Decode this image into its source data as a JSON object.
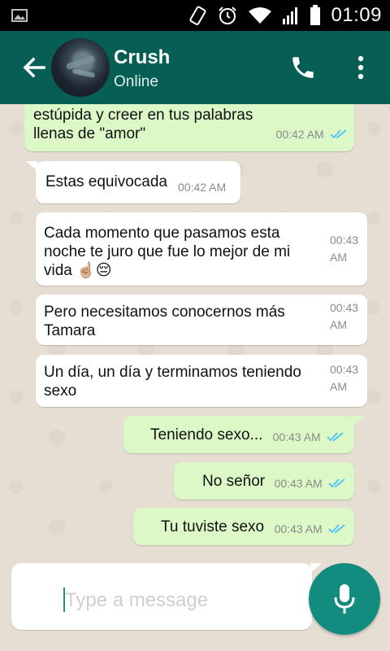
{
  "status_bar": {
    "time": "01:09"
  },
  "header": {
    "contact_name": "Crush",
    "contact_status": "Online"
  },
  "messages": [
    {
      "dir": "in",
      "text": "estúpida y creer en tus palabras llenas de \"amor\"",
      "time": "00:42 AM",
      "read": true,
      "partial": true
    },
    {
      "dir": "in",
      "text": "Estas equivocada",
      "time": "00:42 AM"
    },
    {
      "dir": "in",
      "text": "Cada momento que pasamos esta noche te juro que fue lo mejor de mi vida ☝🏼😔",
      "time": "00:43 AM"
    },
    {
      "dir": "in",
      "text": "Pero necesitamos conocernos más Tamara",
      "time": "00:43 AM"
    },
    {
      "dir": "in",
      "text": "Un día, un día y terminamos teniendo sexo",
      "time": "00:43 AM"
    },
    {
      "dir": "out",
      "text": "Teniendo sexo...",
      "time": "00:43 AM",
      "read": true
    },
    {
      "dir": "out",
      "text": "No señor",
      "time": "00:43 AM",
      "read": true
    },
    {
      "dir": "out",
      "text": "Tu tuviste sexo",
      "time": "00:43 AM",
      "read": true
    }
  ],
  "composer": {
    "placeholder": "Type a message"
  },
  "colors": {
    "header": "#075e54",
    "outgoing_bubble": "#dcf8c6",
    "mic_button": "#128c7e",
    "read_ticks": "#4fc3f7"
  },
  "icons": [
    "image-icon",
    "vibrate-icon",
    "alarm-icon",
    "wifi-icon",
    "signal-icon",
    "battery-icon",
    "back-arrow-icon",
    "phone-icon",
    "more-vert-icon",
    "double-check-icon",
    "microphone-icon"
  ]
}
